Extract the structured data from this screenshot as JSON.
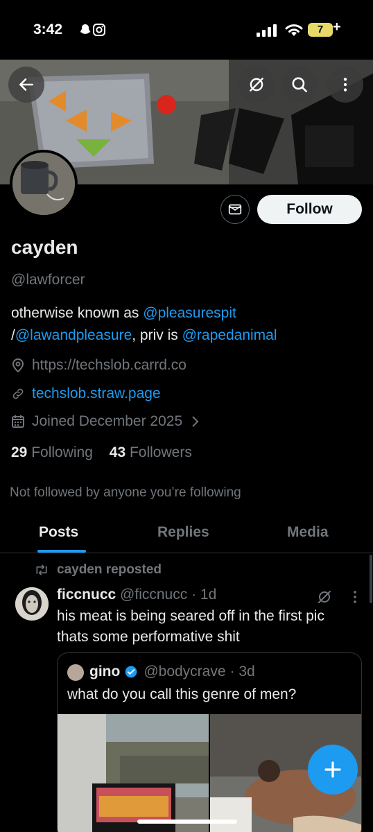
{
  "status_bar": {
    "time": "3:42",
    "battery": "7"
  },
  "profile": {
    "name": "cayden",
    "handle": "@lawforcer",
    "bio": {
      "prefix": "otherwise known as ",
      "mention1": "@pleasurespit",
      "sep": "/",
      "mention2": "@lawandpleasure",
      "middle": ", priv is ",
      "mention3": "@rapedanimal"
    },
    "website": "https://techslob.carrd.co",
    "link": "techslob.straw.page",
    "joined": "Joined December 2025",
    "following_count": "29",
    "following_label": "Following",
    "followers_count": "43",
    "followers_label": "Followers",
    "not_followed": "Not followed by anyone you’re following",
    "follow_label": "Follow"
  },
  "tabs": [
    {
      "label": "Posts"
    },
    {
      "label": "Replies"
    },
    {
      "label": "Media"
    }
  ],
  "post": {
    "repost_label": "cayden reposted",
    "author_name": "ficcnucc",
    "author_handle": "@ficcnucc",
    "time": "· 1d",
    "text": "his meat is being seared off in the first pic thats some performative shit",
    "quote": {
      "author_name": "gino",
      "author_handle": "@bodycrave",
      "time": "· 3d",
      "text": "what do you call this genre of men?"
    }
  },
  "colors": {
    "accent": "#1d9bf0",
    "background": "#000000",
    "muted": "#71767b"
  }
}
